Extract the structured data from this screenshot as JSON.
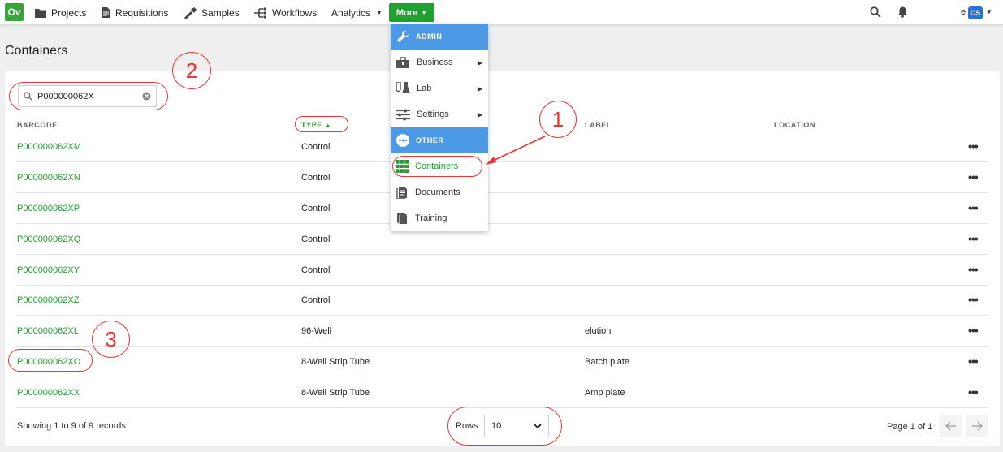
{
  "nav": {
    "logo": "Ov",
    "items": [
      {
        "label": "Projects",
        "icon": "folder-icon"
      },
      {
        "label": "Requisitions",
        "icon": "document-icon"
      },
      {
        "label": "Samples",
        "icon": "pipette-icon"
      },
      {
        "label": "Workflows",
        "icon": "workflow-icon"
      },
      {
        "label": "Analytics",
        "icon": "chevron-down-icon"
      }
    ],
    "more_label": "More",
    "user_initial": "e",
    "avatar": "CS"
  },
  "page": {
    "title": "Containers"
  },
  "search": {
    "value": "P000000062X"
  },
  "table": {
    "columns": [
      "BARCODE",
      "TYPE",
      "LABEL",
      "LOCATION"
    ],
    "rows": [
      {
        "barcode": "P000000062XM",
        "type": "Control",
        "label": "",
        "location": ""
      },
      {
        "barcode": "P000000062XN",
        "type": "Control",
        "label": "",
        "location": ""
      },
      {
        "barcode": "P000000062XP",
        "type": "Control",
        "label": "",
        "location": ""
      },
      {
        "barcode": "P000000062XQ",
        "type": "Control",
        "label": "",
        "location": ""
      },
      {
        "barcode": "P000000062XY",
        "type": "Control",
        "label": "",
        "location": ""
      },
      {
        "barcode": "P000000062XZ",
        "type": "Control",
        "label": "",
        "location": ""
      },
      {
        "barcode": "P000000062XL",
        "type": "96-Well",
        "label": "elution",
        "location": ""
      },
      {
        "barcode": "P000000062XO",
        "type": "8-Well Strip Tube",
        "label": "Batch plate",
        "location": ""
      },
      {
        "barcode": "P000000062XX",
        "type": "8-Well Strip Tube",
        "label": "Amp plate",
        "location": ""
      }
    ],
    "row_menu": "•••"
  },
  "footer": {
    "showing": "Showing 1 to 9 of 9 records",
    "rows_label": "Rows",
    "rows_value": "10",
    "page_info": "Page 1 of 1"
  },
  "menu": {
    "admin_header": "ADMIN",
    "admin_items": [
      "Business",
      "Lab",
      "Settings"
    ],
    "other_header": "OTHER",
    "other_items": [
      "Containers",
      "Documents",
      "Training"
    ]
  },
  "annotations": [
    "1",
    "2",
    "3"
  ],
  "colors": {
    "accent_green": "#22a130",
    "menu_header_blue": "#4c9ae6",
    "annotation_red": "#e33333",
    "avatar_blue": "#2f6fd8"
  }
}
